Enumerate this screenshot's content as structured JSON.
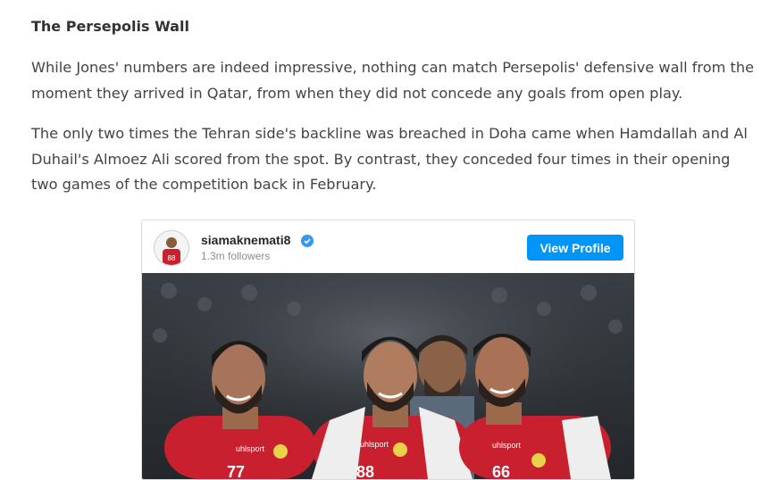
{
  "article": {
    "heading": "The Persepolis Wall",
    "paragraph1": "While Jones' numbers are indeed impressive, nothing can match Persepolis' defensive wall from the moment they arrived in Qatar, from when they did not concede any goals from open play.",
    "paragraph2": "The only two times the Tehran side's backline was breached in Doha came when Hamdallah and Al Duhail's Almoez Ali scored from the spot. By contrast, they conceded four times in their opening two games of the competition back in February."
  },
  "embed": {
    "username": "siamaknemati8",
    "followers": "1.3m followers",
    "view_profile_label": "View Profile",
    "avatar_number": "88",
    "photo": {
      "sponsor_text": "uhlsport",
      "shirt_numbers": [
        "77",
        "88",
        "66"
      ]
    }
  },
  "colors": {
    "button_blue": "#0095f6",
    "jersey_red": "#c8202e"
  }
}
